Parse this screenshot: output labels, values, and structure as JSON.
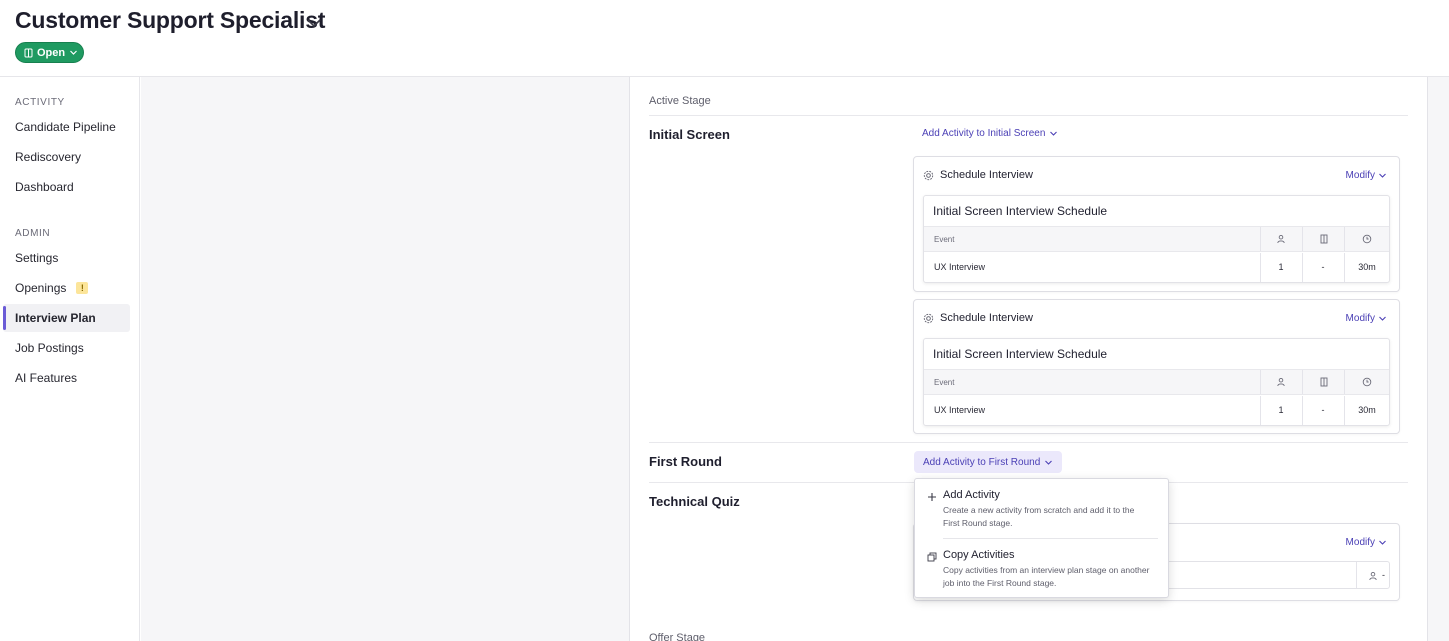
{
  "header": {
    "title": "Customer Support Specialist",
    "status": "Open"
  },
  "sidebar": {
    "activity_heading": "ACTIVITY",
    "activity_items": [
      "Candidate Pipeline",
      "Rediscovery",
      "Dashboard"
    ],
    "admin_heading": "ADMIN",
    "admin_items": [
      "Settings",
      "Openings",
      "Interview Plan",
      "Job Postings",
      "AI Features"
    ],
    "openings_badge": "!",
    "active_item": "Interview Plan"
  },
  "plan": {
    "active_stage_label": "Active Stage",
    "offer_stage_label": "Offer Stage",
    "stages": {
      "initial_screen": {
        "name": "Initial Screen",
        "add_label": "Add Activity to Initial Screen",
        "cards": [
          {
            "type": "Schedule Interview",
            "modify": "Modify",
            "schedule_title": "Initial Screen Interview Schedule",
            "col_event": "Event",
            "row_event": "UX Interview",
            "row_interviewers": "1",
            "row_room": "-",
            "row_duration": "30m"
          },
          {
            "type": "Schedule Interview",
            "modify": "Modify",
            "schedule_title": "Initial Screen Interview Schedule",
            "col_event": "Event",
            "row_event": "UX Interview",
            "row_interviewers": "1",
            "row_room": "-",
            "row_duration": "30m"
          }
        ]
      },
      "first_round": {
        "name": "First Round",
        "add_label": "Add Activity to First Round"
      },
      "technical_quiz": {
        "name": "Technical Quiz",
        "modify": "Modify",
        "partial_value": "-"
      }
    }
  },
  "dropdown": {
    "items": [
      {
        "label": "Add Activity",
        "description": "Create a new activity from scratch and add it to the First Round stage."
      },
      {
        "label": "Copy Activities",
        "description": "Copy activities from an interview plan stage on another job into the First Round stage."
      }
    ]
  },
  "colors": {
    "accent": "#4a3fb5",
    "status_green": "#1f9a61",
    "active_indicator": "#6a5bd6",
    "warning": "#fce59a"
  },
  "icons": [
    "chevron-down-icon",
    "job-icon",
    "gear-icon",
    "person-icon",
    "room-icon",
    "clock-icon",
    "plus-icon",
    "copy-icon"
  ]
}
